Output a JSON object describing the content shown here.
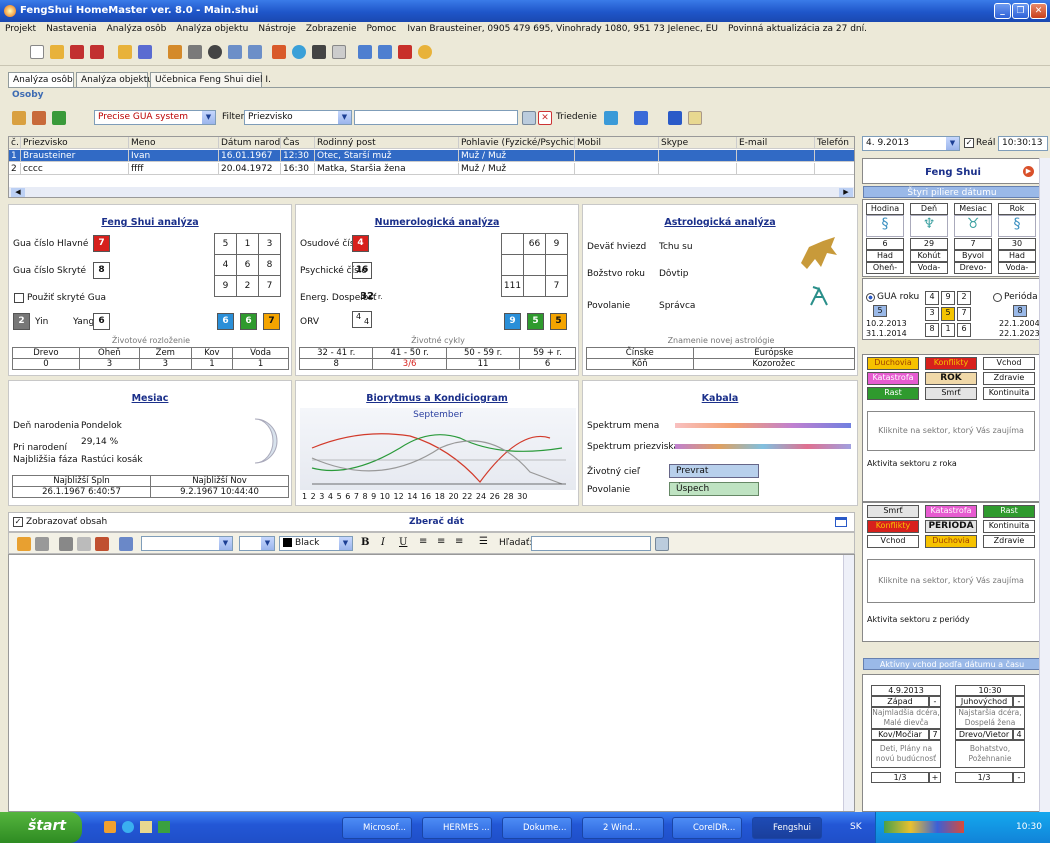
{
  "window": {
    "title": "FengShui HomeMaster ver. 8.0 - Main.shui"
  },
  "menu": {
    "items": [
      "Projekt",
      "Nastavenia",
      "Analýza osôb",
      "Analýza objektu",
      "Nástroje",
      "Zobrazenie",
      "Pomoc"
    ],
    "user_info": "Ivan Brausteiner, 0905 479 695, Vinohrady 1080, 951 73 Jelenec, EU",
    "update_notice": "Povinná aktualizácia za 27 dní."
  },
  "tabs": [
    "Analýza osôb",
    "Analýza objektu",
    "Učebnica Feng Shui diel I."
  ],
  "group_label": "Osoby",
  "toolbar2": {
    "system_select": "Precise GUA system",
    "filter_label": "Filter",
    "filter_select": "Priezvisko",
    "filter_value": "",
    "sort_label": "Triedenie"
  },
  "grid": {
    "columns": [
      "č.",
      "Priezvisko",
      "Meno",
      "Dátum narodenia",
      "Čas",
      "Rodinný post",
      "Pohlavie (Fyzické/Psychické)",
      "Mobil",
      "Skype",
      "E-mail",
      "Telefón"
    ],
    "rows": [
      [
        "1",
        "Brausteiner",
        "Ivan",
        "16.01.1967",
        "12:30",
        "Otec, Starší muž",
        "Muž / Muž",
        "",
        "",
        "",
        ""
      ],
      [
        "2",
        "cccc",
        "ffff",
        "20.04.1972",
        "16:30",
        "Matka, Staršia žena",
        "Muž / Muž",
        "",
        "",
        "",
        ""
      ]
    ]
  },
  "fengshui": {
    "title": "Feng Shui analýza",
    "gua_main_label": "Gua číslo Hlavné",
    "gua_main": "7",
    "gua_hidden_label": "Gua číslo Skryté",
    "gua_hidden": "8",
    "use_hidden_label": "Použiť skryté Gua",
    "yin_value": "2",
    "yin_label": "Yin",
    "yang_label": "Yang",
    "yang_value": "6",
    "grid": [
      [
        "5",
        "1",
        "3"
      ],
      [
        "4",
        "6",
        "8"
      ],
      [
        "9",
        "2",
        "7"
      ]
    ],
    "bottom": [
      "6",
      "6",
      "7"
    ],
    "life_layout": "Životové rozloženie",
    "elements": [
      "Drevo",
      "Oheň",
      "Zem",
      "Kov",
      "Voda"
    ],
    "element_values": [
      "0",
      "3",
      "3",
      "1",
      "1"
    ]
  },
  "numerology": {
    "title": "Numerologická analýza",
    "destiny_label": "Osudové číslo",
    "destiny": "4",
    "psychic_label": "Psychické číslo",
    "psychic": "16",
    "energy_label": "Energ. Dospelosť",
    "energy": "32",
    "energy_unit": "r.",
    "orv_label": "ORV",
    "orv": "4",
    "orv_sub": "4",
    "grid": [
      [
        "",
        "66",
        "9"
      ],
      [
        "",
        "",
        ""
      ],
      [
        "111",
        "",
        "7"
      ]
    ],
    "bottom": [
      "9",
      "5",
      "5"
    ],
    "cycles_label": "Životné cykly",
    "cycles": [
      "32 - 41 r.",
      "41 - 50 r.",
      "50 - 59 r.",
      "59 + r."
    ],
    "cycle_values": [
      "8",
      "3/6",
      "11",
      "6"
    ]
  },
  "astrology": {
    "title": "Astrologická analýza",
    "nine_stars_label": "Deväť hviezd",
    "nine_stars": "Tchu su",
    "deity_label": "Božstvo roku",
    "deity": "Dôvtip",
    "calling_label": "Povolanie",
    "calling": "Správca",
    "sign_label": "Znamenie novej astrológie",
    "headers": [
      "Čínske",
      "Európske"
    ],
    "values": [
      "Kôň",
      "Kozorožec"
    ]
  },
  "moon": {
    "title": "Mesiac",
    "birthday_label": "Deň narodenia",
    "birthday": "Pondelok",
    "at_birth_label": "Pri narodení",
    "at_birth": "29,14 %",
    "phase_label": "Najbližšia fáza",
    "phase": "Rastúci kosák",
    "full_label": "Najbližší Spln",
    "new_label": "Najbližší Nov",
    "full": "26.1.1967 6:40:57",
    "new": "9.2.1967 10:44:40"
  },
  "biorhythm": {
    "title": "Biorytmus a Kondiciogram",
    "month": "September",
    "days": [
      "1",
      "2",
      "3",
      "4",
      "5",
      "6",
      "7",
      "8",
      "9",
      "10",
      "12",
      "14",
      "16",
      "18",
      "20",
      "22",
      "24",
      "26",
      "28",
      "30"
    ]
  },
  "kabala": {
    "title": "Kabala",
    "name_spectrum": "Spektrum mena",
    "surname_spectrum": "Spektrum priezviska",
    "life_goal_label": "Životný cieľ",
    "life_goal": "Prevrat",
    "calling_label": "Povolanie",
    "calling": "Úspech"
  },
  "zberac": {
    "show_label": "Zobrazovať obsah",
    "title": "Zberač dát",
    "color": "Black",
    "search_label": "Hľadať:"
  },
  "right": {
    "date": "4. 9.2013",
    "real_label": "Reál",
    "time": "10:30:13",
    "fs_title": "Feng Shui",
    "pillars_title": "Štyri piliere dátumu",
    "pillar_heads": [
      "Hodina",
      "Deň",
      "Mesiac",
      "Rok"
    ],
    "pillar_nums": [
      "6",
      "29",
      "7",
      "30"
    ],
    "pillar_animals": [
      "Had",
      "Kohút",
      "Byvol",
      "Had"
    ],
    "pillar_elements": [
      "Oheň-",
      "Voda-",
      "Drevo-",
      "Voda-"
    ],
    "gua_year_label": "GUA roku",
    "period_label": "Perióda",
    "gua_year": "5",
    "period": "8",
    "d1": "10.2.2013",
    "d2": "31.1.2014",
    "d3": "22.1.2004",
    "d4": "22.1.2023",
    "mini": [
      [
        "4",
        "9",
        "2"
      ],
      [
        "3",
        "5",
        "7"
      ],
      [
        "8",
        "1",
        "6"
      ]
    ],
    "sect1": [
      [
        "Duchovia",
        "Konflikty",
        "Vchod"
      ],
      [
        "Katastrofa",
        "ROK",
        "Zdravie"
      ],
      [
        "Rast",
        "Smrť",
        "Kontinuita"
      ]
    ],
    "sect1_hint": "Kliknite na sektor, ktorý Vás zaujíma",
    "sect1_activity": "Aktivita sektoru z roka",
    "sect2": [
      [
        "Smrť",
        "Katastrofa",
        "Rast"
      ],
      [
        "Konflikty",
        "PERIÓDA",
        "Kontinuita"
      ],
      [
        "Vchod",
        "Duchovia",
        "Zdravie"
      ]
    ],
    "sect2_hint": "Kliknite na sektor, ktorý Vás zaujíma",
    "sect2_activity": "Aktivita sektoru z periódy",
    "active_title": "Aktívny vchod podľa dátumu a času",
    "left_col": {
      "date": "4.9.2013",
      "dir": "Západ",
      "person": "Najmladšia dcéra, Malé dievča",
      "elem": "Kov/Močiar",
      "num": "7",
      "aspect": "Deti, Plány na novú budúcnosť",
      "frac": "1/3"
    },
    "right_col": {
      "time": "10:30",
      "dir": "Juhovýchod",
      "person": "Najstaršia dcéra, Dospelá žena",
      "elem": "Drevo/Vietor",
      "num": "4",
      "aspect": "Bohatstvo, Požehnanie",
      "frac": "1/3"
    }
  },
  "taskbar": {
    "start": "štart",
    "tasks": [
      "Microsof...",
      "HERMES ...",
      "Dokume...",
      "2 Wind...",
      "CorelDR...",
      "Fengshui"
    ],
    "lang": "SK",
    "clock": "10:30"
  },
  "colors": {
    "red": "#d7201c",
    "green": "#2f9a2e",
    "orange": "#f4a400",
    "blue": "#2a8fd8",
    "titlebar": "#1f56c9",
    "selection": "#316ac5"
  }
}
